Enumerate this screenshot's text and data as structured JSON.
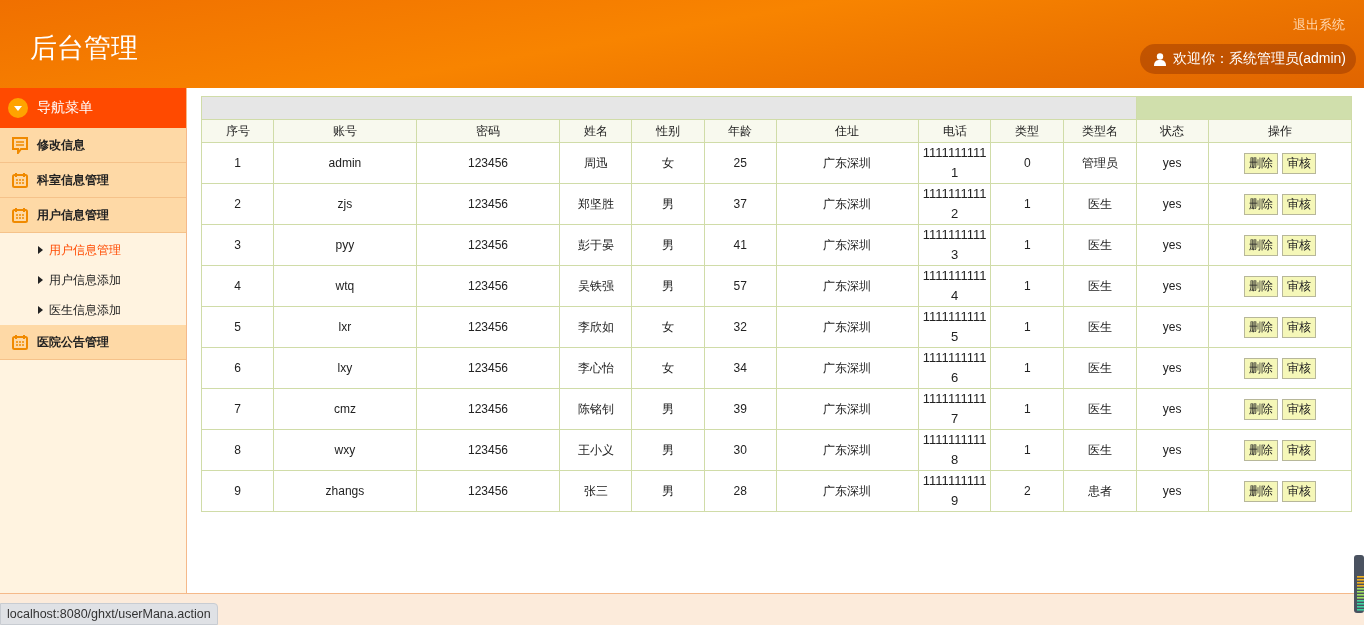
{
  "header": {
    "title": "后台管理",
    "logout": "退出系统",
    "welcome": "欢迎你：系统管理员(admin)"
  },
  "sidebar": {
    "title": "导航菜单",
    "groups": [
      {
        "label": "修改信息"
      },
      {
        "label": "科室信息管理"
      },
      {
        "label": "用户信息管理",
        "children": [
          {
            "label": "用户信息管理",
            "selected": true
          },
          {
            "label": "用户信息添加",
            "selected": false
          },
          {
            "label": "医生信息添加",
            "selected": false
          }
        ]
      },
      {
        "label": "医院公告管理"
      }
    ]
  },
  "table": {
    "columns": [
      "序号",
      "账号",
      "密码",
      "姓名",
      "性别",
      "年龄",
      "住址",
      "电话",
      "类型",
      "类型名",
      "状态",
      "操作"
    ],
    "rows": [
      {
        "cells": [
          "1",
          "admin",
          "123456",
          "周迅",
          "女",
          "25",
          "广东深圳",
          "11111111111",
          "0",
          "管理员",
          "yes"
        ],
        "actions": [
          "删除",
          "审核"
        ]
      },
      {
        "cells": [
          "2",
          "zjs",
          "123456",
          "郑坚胜",
          "男",
          "37",
          "广东深圳",
          "11111111112",
          "1",
          "医生",
          "yes"
        ],
        "actions": [
          "删除",
          "审核"
        ]
      },
      {
        "cells": [
          "3",
          "pyy",
          "123456",
          "彭于晏",
          "男",
          "41",
          "广东深圳",
          "11111111113",
          "1",
          "医生",
          "yes"
        ],
        "actions": [
          "删除",
          "审核"
        ]
      },
      {
        "cells": [
          "4",
          "wtq",
          "123456",
          "吴铁强",
          "男",
          "57",
          "广东深圳",
          "11111111114",
          "1",
          "医生",
          "yes"
        ],
        "actions": [
          "删除",
          "审核"
        ]
      },
      {
        "cells": [
          "5",
          "lxr",
          "123456",
          "李欣如",
          "女",
          "32",
          "广东深圳",
          "11111111115",
          "1",
          "医生",
          "yes"
        ],
        "actions": [
          "删除",
          "审核"
        ]
      },
      {
        "cells": [
          "6",
          "lxy",
          "123456",
          "李心怡",
          "女",
          "34",
          "广东深圳",
          "11111111116",
          "1",
          "医生",
          "yes"
        ],
        "actions": [
          "删除",
          "审核"
        ]
      },
      {
        "cells": [
          "7",
          "cmz",
          "123456",
          "陈铭钊",
          "男",
          "39",
          "广东深圳",
          "11111111117",
          "1",
          "医生",
          "yes"
        ],
        "actions": [
          "删除",
          "审核"
        ]
      },
      {
        "cells": [
          "8",
          "wxy",
          "123456",
          "王小义",
          "男",
          "30",
          "广东深圳",
          "11111111118",
          "1",
          "医生",
          "yes"
        ],
        "actions": [
          "删除",
          "审核"
        ]
      },
      {
        "cells": [
          "9",
          "zhangs",
          "123456",
          "张三",
          "男",
          "28",
          "广东深圳",
          "11111111119",
          "2",
          "患者",
          "yes"
        ],
        "actions": [
          "删除",
          "审核"
        ]
      }
    ]
  },
  "status_url": "localhost:8080/ghxt/userMana.action"
}
